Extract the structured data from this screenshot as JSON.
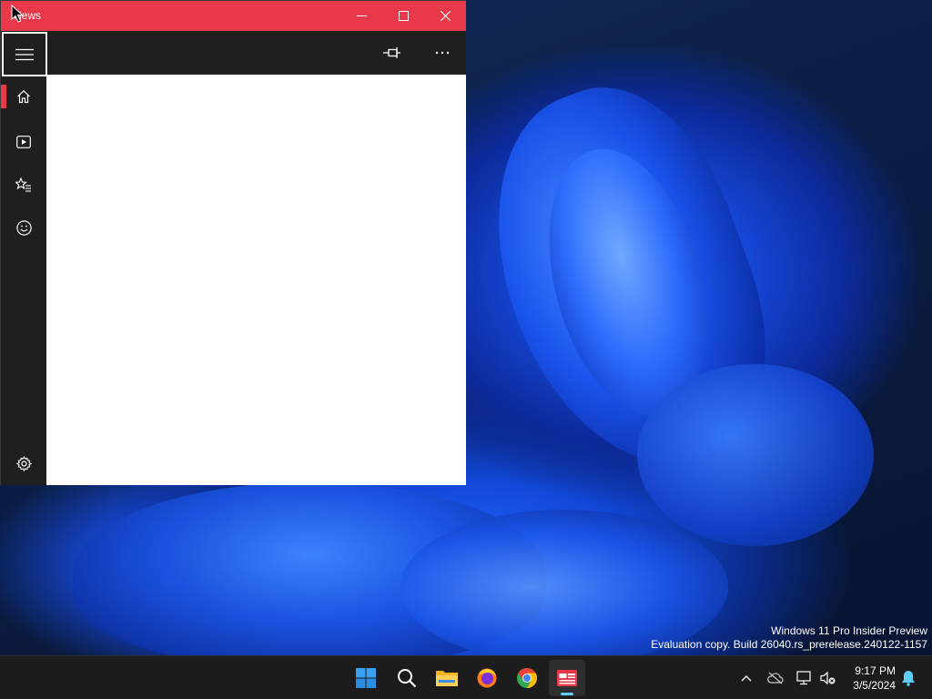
{
  "window": {
    "title": "News",
    "controls": {
      "minimize": "minimize",
      "maximize": "maximize",
      "close": "close"
    }
  },
  "nav": {
    "items": [
      {
        "id": "home",
        "icon": "home-icon",
        "active": true
      },
      {
        "id": "video",
        "icon": "video-icon",
        "active": false
      },
      {
        "id": "favorites",
        "icon": "star-list-icon",
        "active": false
      },
      {
        "id": "interests",
        "icon": "smiley-icon",
        "active": false
      }
    ],
    "settings_icon": "gear-icon"
  },
  "toolbar": {
    "pin_icon": "pin-icon",
    "more_icon": "more-icon"
  },
  "desktop": {
    "watermark_line1": "Windows 11 Pro Insider Preview",
    "watermark_line2": "Evaluation copy. Build 26040.rs_prerelease.240122-1157"
  },
  "taskbar": {
    "apps": [
      {
        "name": "start",
        "icon": "windows-start-icon"
      },
      {
        "name": "search",
        "icon": "search-icon"
      },
      {
        "name": "file-explorer",
        "icon": "folder-icon"
      },
      {
        "name": "firefox",
        "icon": "firefox-icon"
      },
      {
        "name": "chrome",
        "icon": "chrome-icon"
      },
      {
        "name": "news",
        "icon": "news-icon",
        "active": true
      }
    ],
    "time": "9:17 PM",
    "date": "3/5/2024"
  },
  "colors": {
    "accent": "#e8384a",
    "taskbar": "#1c1c1c",
    "indicator": "#60cdff"
  }
}
